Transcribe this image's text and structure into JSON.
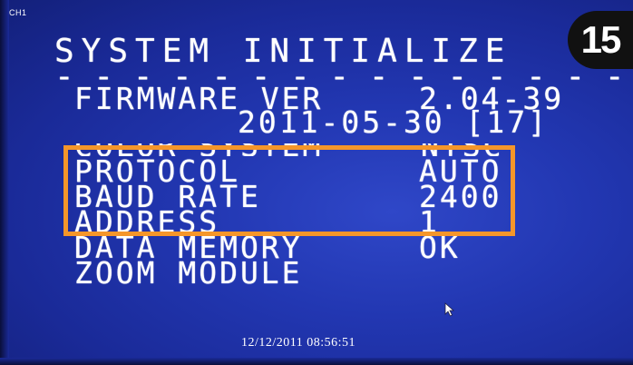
{
  "channel_label": "CH1",
  "step_badge": "15",
  "menu": {
    "title": "SYSTEM INITIALIZE",
    "separator": "- - - - - - - - - - - - - - - -",
    "firmware_label": "FIRMWARE VER",
    "firmware_value": "2.04-39",
    "firmware_date": "2011-05-30 [17]",
    "color_system_label": "COLOR SYSTEM",
    "color_system_value": "NTSC",
    "protocol_label": "PROTOCOL",
    "protocol_value": "AUTO",
    "baud_rate_label": "BAUD RATE",
    "baud_rate_value": "2400",
    "address_label": "ADDRESS",
    "address_value": "1",
    "data_memory_label": "DATA MEMORY",
    "data_memory_value": "OK",
    "zoom_module_label": "ZOOM MODULE"
  },
  "timestamp": "12/12/2011 08:56:51",
  "highlight_color": "#f5962a",
  "icons": [
    "mouse-pointer-icon"
  ]
}
